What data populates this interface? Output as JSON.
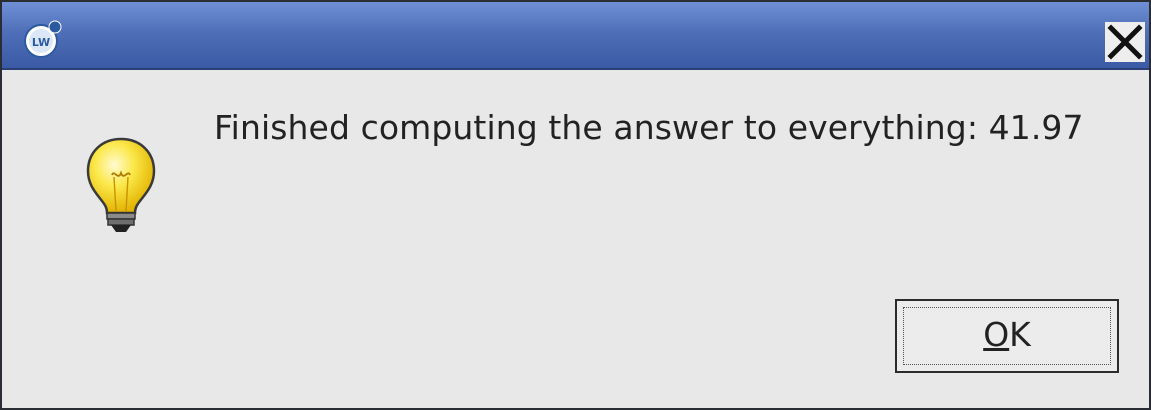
{
  "window": {
    "icon": "lw-app-icon",
    "close_icon": "close-icon"
  },
  "dialog": {
    "icon": "lightbulb-icon",
    "message": "Finished computing the answer to everything: 41.97",
    "ok_button": {
      "mnemonic": "O",
      "rest": "K"
    }
  },
  "colors": {
    "titlebar": "#4f6fb8",
    "background": "#e8e8e8"
  }
}
